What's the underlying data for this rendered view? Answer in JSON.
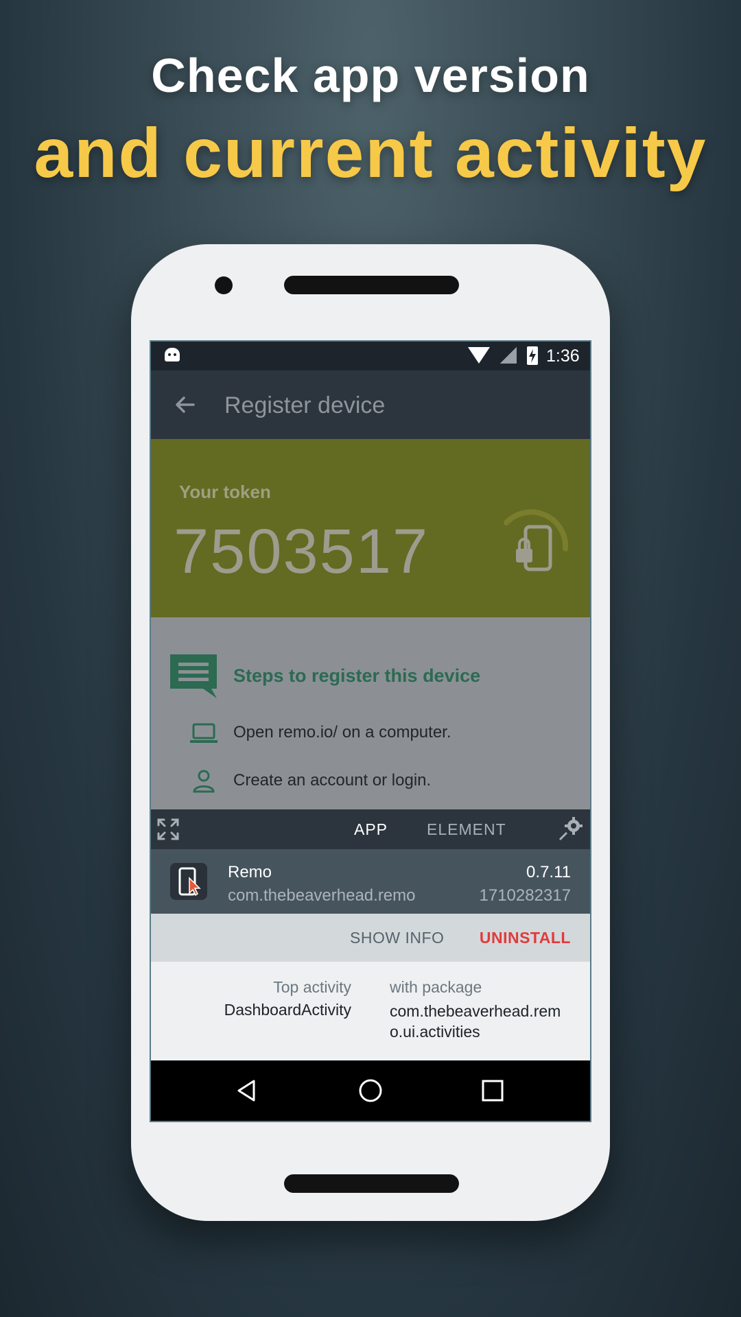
{
  "promo": {
    "line1": "Check app version",
    "line2": "and current activity"
  },
  "status_bar": {
    "time": "1:36",
    "icons": [
      "android-debug-icon",
      "wifi-icon",
      "no-signal-icon",
      "battery-charging-icon"
    ]
  },
  "app_bar": {
    "back_icon": "arrow-left-icon",
    "title": "Register device"
  },
  "token_card": {
    "label": "Your token",
    "value": "7503517",
    "icon": "phone-lock-icon",
    "color": "#636a22"
  },
  "steps": {
    "title": "Steps to register this device",
    "items": [
      {
        "icon": "laptop-icon",
        "text": "Open remo.io/ on a computer."
      },
      {
        "icon": "person-icon",
        "text": "Create an account or login."
      }
    ]
  },
  "inspector": {
    "tabs": [
      {
        "label": "APP",
        "selected": true
      },
      {
        "label": "ELEMENT",
        "selected": false
      }
    ],
    "app": {
      "name": "Remo",
      "package": "com.thebeaverhead.remo",
      "version": "0.7.11",
      "version_code": "1710282317"
    },
    "actions": {
      "show_info": "SHOW INFO",
      "uninstall": "UNINSTALL"
    },
    "activity": {
      "top_activity_label": "Top activity",
      "top_activity_value": "DashboardActivity",
      "package_label": "with package",
      "package_value": "com.thebeaverhead.remo.ui.activities"
    }
  },
  "colors": {
    "accent": "#f7c948",
    "uninstall": "#e03b3b",
    "steps_green": "#2c6a52"
  }
}
